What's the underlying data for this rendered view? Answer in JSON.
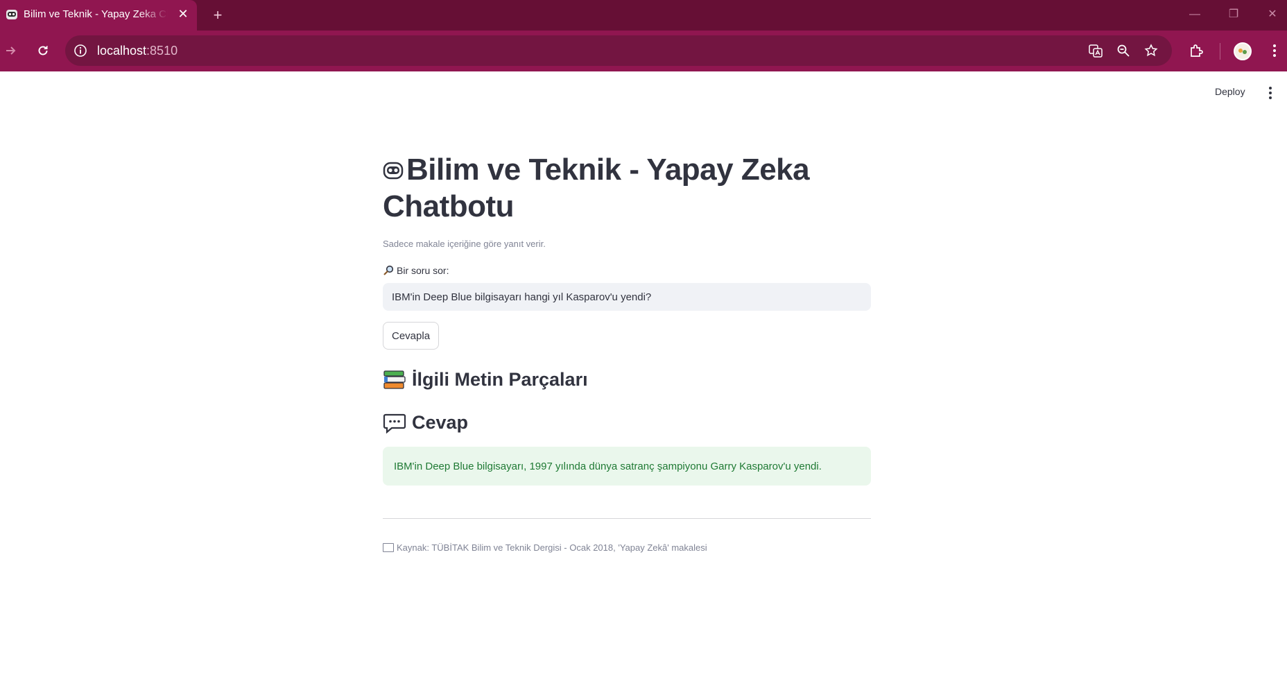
{
  "browser": {
    "tab_title": "Bilim ve Teknik - Yapay Zeka Chatbotu",
    "new_tab_symbol": "+",
    "close_symbol": "✕",
    "url_host": "localhost",
    "url_port": ":8510",
    "window_controls": [
      "—",
      "❐",
      "✕"
    ],
    "colors": {
      "tabbar": "#660f35",
      "toolbar": "#901650",
      "omnibox": "#731541"
    }
  },
  "app_header": {
    "deploy_label": "Deploy"
  },
  "main": {
    "title": "Bilim ve Teknik - Yapay Zeka Chatbotu",
    "title_icon": "robot-face-icon",
    "caption": "Sadece makale içeriğine göre yanıt verir.",
    "input_label": "Bir soru sor:",
    "input_label_icon": "magnifier-icon",
    "question_value": "IBM'in Deep Blue bilgisayarı hangi yıl Kasparov'u yendi?",
    "answer_button_label": "Cevapla",
    "passages_heading": "İlgili Metin Parçaları",
    "passages_icon": "books-icon",
    "answer_heading": "Cevap",
    "answer_icon": "speech-bubble-icon",
    "answer_text": "IBM'in Deep Blue bilgisayarı, 1997 yılında dünya satranç şampiyonu Garry Kasparov'u yendi.",
    "source_note": "Kaynak: TÜBİTAK Bilim ve Teknik Dergisi - Ocak 2018, 'Yapay Zekâ' makalesi",
    "source_icon": "book-icon",
    "colors": {
      "text": "#31333f",
      "caption": "#808495",
      "input_bg": "#f0f2f6",
      "success_bg": "#eaf7ec",
      "success_text": "#1f7a34"
    }
  }
}
